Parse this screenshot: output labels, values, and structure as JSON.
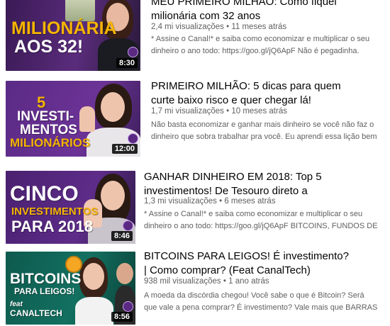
{
  "videos": [
    {
      "title_lines": [
        "MEU PRIMEIRO MILHÃO: Como fiquei",
        "milionária com 32 anos"
      ],
      "views": "2,4 mi visualizações",
      "sep": "•",
      "age": "11 meses atrás",
      "desc_lines": [
        "* Assine o Canal!* e saiba como economizar e multiplicar o seu",
        "dinheiro o ano todo: https://goo.gl/jQ6ApF Não é pegadinha."
      ],
      "thumb": {
        "line1": "MILIONÁRIA",
        "line2": "AOS 32!",
        "duration": "8:30"
      },
      "colors": {
        "bg": "#4a2266",
        "text": "#f5b400"
      }
    },
    {
      "title_lines": [
        "PRIMEIRO MILHÃO: 5 dicas para quem",
        "curte baixo risco e quer chegar lá!"
      ],
      "views": "1,7 mi visualizações",
      "sep": "•",
      "age": "10 meses atrás",
      "desc_lines": [
        "Não basta economizar e ganhar mais dinheiro se você não faz o",
        "dinheiro que sobra trabalhar pra você. Eu aprendi essa lição bem"
      ],
      "thumb": {
        "line1": "5",
        "line2": "INVESTI-",
        "line3": "MENTOS",
        "line4": "MILIONÁRIOS",
        "duration": "12:00"
      },
      "colors": {
        "bg": "#5b2a86",
        "text": "#f5b400"
      }
    },
    {
      "title_lines": [
        "GANHAR DINHEIRO EM 2018: Top 5",
        "investimentos! De Tesouro direto a"
      ],
      "views": "1,3 mi visualizações",
      "sep": "•",
      "age": "6 meses atrás",
      "desc_lines": [
        "* Assine o Canal!* e saiba como economizar e multiplicar o seu",
        "dinheiro o ano todo: https://goo.gl/jQ6ApF BITCOINS, FUNDOS DE"
      ],
      "thumb": {
        "line1": "CINCO",
        "line2": "INVESTIMENTOS",
        "line3": "PARA 2018",
        "duration": "8:46"
      },
      "colors": {
        "bg": "#55257f",
        "text": "#ffffff",
        "accent": "#f5b400"
      }
    },
    {
      "title_lines": [
        "BITCOINS PARA LEIGOS! É investimento?",
        "| Como comprar? (Feat CanalTech)"
      ],
      "views": "938 mil visualizações",
      "sep": "•",
      "age": "1 ano atrás",
      "desc_lines": [
        "A moeda da discórdia chegou! Você sabe o que é Bitcoin? Será",
        "que vale a pena comprar? É investimento? Vale mais que BARRAS"
      ],
      "thumb": {
        "line1": "BITCOINS",
        "line2": "PARA LEIGOS!",
        "line3": "feat",
        "line4": "CANALTECH",
        "duration": "8:56"
      },
      "colors": {
        "bg": "#0f5b4f",
        "text": "#ffffff"
      }
    }
  ]
}
